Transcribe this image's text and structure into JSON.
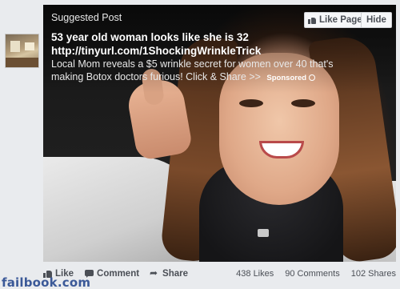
{
  "post": {
    "label": "Suggested Post",
    "headline": "53 year old woman looks like she is 32",
    "link": "http://tinyurl.com/1ShockingWrinkleTrick",
    "description": "Local Mom reveals a $5 wrinkle secret for women over 40 that's making Botox doctors furious! Click & Share >>",
    "sponsored": "Sponsored"
  },
  "buttons": {
    "like_page": "Like Page",
    "hide": "Hide"
  },
  "actions": {
    "like": "Like",
    "comment": "Comment",
    "share": "Share"
  },
  "stats": {
    "likes": "438 Likes",
    "comments": "90 Comments",
    "shares": "102 Shares"
  },
  "watermark": "failbook.com",
  "colors": {
    "brand": "#3b5998",
    "page_bg": "#e9ebee"
  }
}
